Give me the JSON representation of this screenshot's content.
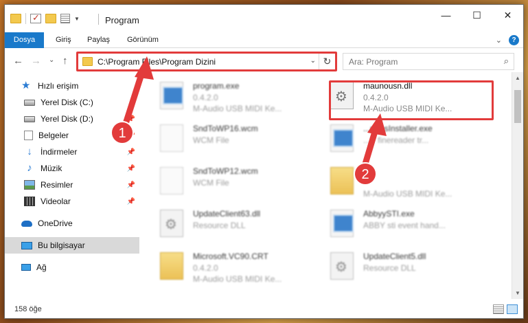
{
  "window": {
    "title": "Program",
    "controls": {
      "minimize": "—",
      "maximize": "☐",
      "close": "✕"
    }
  },
  "ribbon": {
    "tabs": [
      "Dosya",
      "Giriş",
      "Paylaş",
      "Görünüm"
    ],
    "help": "?"
  },
  "address": {
    "path": "C:\\Program Files\\Program Dizini",
    "refresh": "↻",
    "dropdown": "⌄"
  },
  "search": {
    "placeholder": "Ara: Program"
  },
  "nav": {
    "back": "←",
    "forward": "→",
    "recent": "⌄",
    "up": "↑"
  },
  "sidebar": {
    "items": [
      {
        "label": "Hızlı erişim",
        "icon": "star-icon"
      },
      {
        "label": "Yerel Disk (C:)",
        "icon": "disk-icon"
      },
      {
        "label": "Yerel Disk (D:)",
        "icon": "disk-icon"
      },
      {
        "label": "Belgeler",
        "icon": "documents-icon"
      },
      {
        "label": "İndirmeler",
        "icon": "downloads-icon"
      },
      {
        "label": "Müzik",
        "icon": "music-icon"
      },
      {
        "label": "Resimler",
        "icon": "pictures-icon"
      },
      {
        "label": "Videolar",
        "icon": "videos-icon"
      },
      {
        "label": "OneDrive",
        "icon": "onedrive-icon"
      },
      {
        "label": "Bu bilgisayar",
        "icon": "computer-icon"
      },
      {
        "label": "Ağ",
        "icon": "network-icon"
      }
    ]
  },
  "files": [
    {
      "name": "program.exe",
      "line1": "0.4.2.0",
      "line2": "M-Audio USB MIDI Ke...",
      "icon": "exe-icon"
    },
    {
      "name": "maunousn.dll",
      "line1": "0.4.2.0",
      "line2": "M-Audio USB MIDI Ke...",
      "icon": "dll-icon"
    },
    {
      "name": "SndToWP16.wcm",
      "line1": "WCM File",
      "line2": "",
      "icon": "file-icon"
    },
    {
      "name": "...ramsInstaller.exe",
      "line1": "...Y finereader tr...",
      "line2": "",
      "icon": "exe-icon"
    },
    {
      "name": "SndToWP12.wcm",
      "line1": "WCM File",
      "line2": "",
      "icon": "file-icon"
    },
    {
      "name": "",
      "line1": "M-Audio USB MIDI Ke...",
      "line2": "",
      "icon": "folder-icon"
    },
    {
      "name": "UpdateClient63.dll",
      "line1": "Resource DLL",
      "line2": "",
      "icon": "dll-icon"
    },
    {
      "name": "AbbyySTI.exe",
      "line1": "ABBY sti event hand...",
      "line2": "",
      "icon": "exe-icon"
    },
    {
      "name": "Microsoft.VC90.CRT",
      "line1": "0.4.2.0",
      "line2": "M-Audio USB MIDI Ke...",
      "icon": "folder-icon"
    },
    {
      "name": "UpdateClient5.dll",
      "line1": "Resource DLL",
      "line2": "",
      "icon": "dll-icon"
    }
  ],
  "markers": {
    "one": "1",
    "two": "2"
  },
  "status": {
    "count": "158 öğe"
  },
  "colors": {
    "accent": "#1979ca",
    "highlight": "#e23b3b"
  }
}
